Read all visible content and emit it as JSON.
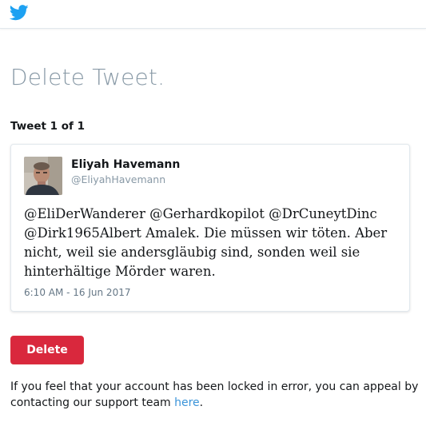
{
  "header": {
    "logo_icon": "twitter-bird-icon",
    "brand_color": "#1da1f2"
  },
  "page": {
    "title": "Delete Tweet",
    "title_suffix": ".",
    "tweet_count": "Tweet 1 of 1"
  },
  "tweet": {
    "display_name": "Eliyah Havemann",
    "handle": "@EliyahHavemann",
    "text": "@EliDerWanderer @Gerhardkopilot @DrCuneytDinc @Dirk1965Albert Amalek. Die müssen wir töten. Aber nicht, weil sie andersgläubig sind, sonden weil sie hinterhältige Mörder waren.",
    "timestamp": "6:10 AM - 16 Jun 2017"
  },
  "actions": {
    "delete_label": "Delete",
    "delete_color": "#d9283d"
  },
  "appeal": {
    "text_before": "If you feel that your account has been locked in error, you can appeal by contacting our support team ",
    "link_text": "here",
    "text_after": "."
  }
}
